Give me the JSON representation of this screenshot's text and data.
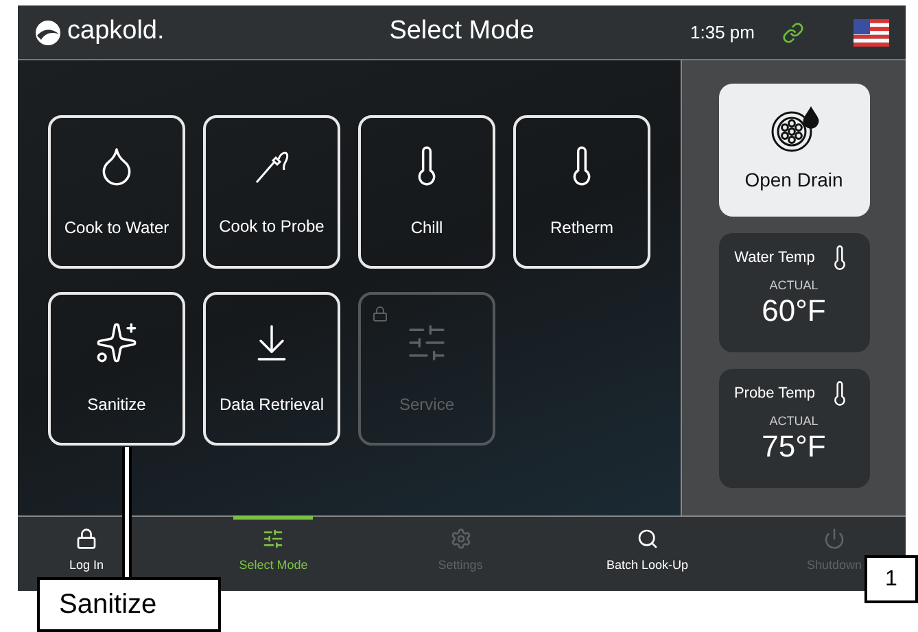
{
  "header": {
    "logo": "capkold.",
    "title": "Select Mode",
    "time": "1:35 pm"
  },
  "modes": [
    {
      "kind": "water",
      "label": "Cook to Water",
      "disabled": false
    },
    {
      "kind": "probe",
      "label": "Cook to Probe",
      "disabled": false
    },
    {
      "kind": "chill",
      "label": "Chill",
      "disabled": false
    },
    {
      "kind": "retherm",
      "label": "Retherm",
      "disabled": false
    },
    {
      "kind": "sanitize",
      "label": "Sanitize",
      "disabled": false
    },
    {
      "kind": "data",
      "label": "Data Retrieval",
      "disabled": false
    },
    {
      "kind": "service",
      "label": "Service",
      "disabled": true
    }
  ],
  "drain": {
    "label": "Open Drain"
  },
  "temps": [
    {
      "label": "Water Temp",
      "caption": "ACTUAL",
      "value": "60°F"
    },
    {
      "label": "Probe Temp",
      "caption": "ACTUAL",
      "value": "75°F"
    }
  ],
  "nav": [
    {
      "kind": "login",
      "label": "Log In",
      "selected": false,
      "disabled": false
    },
    {
      "kind": "mode",
      "label": "Select Mode",
      "selected": true,
      "disabled": false
    },
    {
      "kind": "settings",
      "label": "Settings",
      "selected": false,
      "disabled": true
    },
    {
      "kind": "search",
      "label": "Batch Look-Up",
      "selected": false,
      "disabled": false
    },
    {
      "kind": "power",
      "label": "Shutdown",
      "selected": false,
      "disabled": true
    }
  ],
  "callout": {
    "label": "Sanitize",
    "figure_number": "1"
  }
}
